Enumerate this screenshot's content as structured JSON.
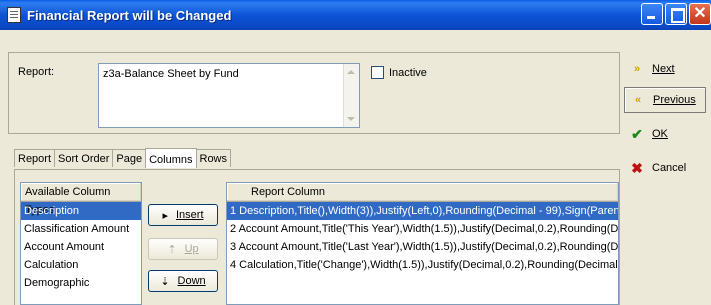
{
  "window": {
    "title": "Financial Report will be Changed"
  },
  "report": {
    "label": "Report:",
    "value": "z3a-Balance Sheet by Fund",
    "inactive_label": "Inactive"
  },
  "tabs": [
    "Report",
    "Sort Order",
    "Page",
    "Columns",
    "Rows"
  ],
  "active_tab": "Columns",
  "available_columns": {
    "header": "Available Column Types",
    "items": [
      "Description",
      "Classification Amount",
      "Account Amount",
      "Calculation",
      "Demographic"
    ],
    "selected_index": 0
  },
  "mid_buttons": {
    "insert": "Insert",
    "up": "Up",
    "down": "Down"
  },
  "report_columns": {
    "header": "Report Column",
    "items": [
      "1 Description,Title(),Width(3)),Justify(Left,0),Rounding(Decimal - 99),Sign(Paren",
      "2 Account Amount,Title('This Year'),Width(1.5)),Justify(Decimal,0.2),Rounding(D",
      "3 Account Amount,Title('Last Year'),Width(1.5)),Justify(Decimal,0.2),Rounding(D",
      "4 Calculation,Title('Change'),Width(1.5)),Justify(Decimal,0.2),Rounding(Decimal"
    ],
    "selected_index": 0
  },
  "side_buttons": {
    "next": "Next",
    "previous": "Previous",
    "ok": "OK",
    "cancel": "Cancel"
  },
  "colors": {
    "title_bar": "#0c54d6",
    "selection": "#316ac5",
    "dialog_bg": "#ece9d8"
  }
}
